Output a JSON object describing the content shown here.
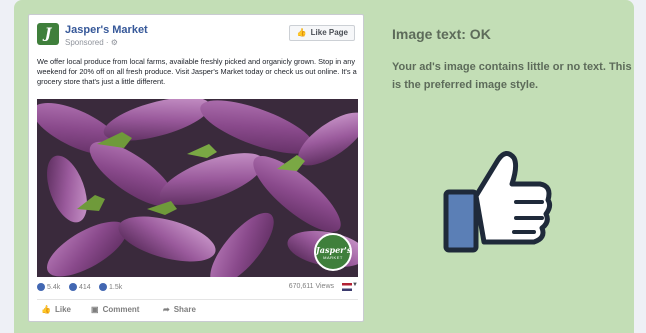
{
  "post": {
    "page_name": "Jasper's Market",
    "logo_letter": "J",
    "sponsored": "Sponsored · ⚙",
    "like_page_label": "Like Page",
    "body": "We offer local produce from local farms, available freshly picked and organicly grown. Stop in any weekend for 20% off on all fresh produce. Visit Jasper's Market today or check us out online. It's a grocery store that's just a little different.",
    "badge_name": "Jasper's",
    "badge_sub": "MARKET",
    "stats": {
      "likes": "5.4k",
      "comments": "414",
      "shares": "1.5k",
      "views": "670,611 Views"
    },
    "actions": {
      "like": "Like",
      "comment": "Comment",
      "share": "Share"
    }
  },
  "info": {
    "heading": "Image text: OK",
    "description": "Your ad's image contains little or no text. This is the preferred image style."
  },
  "colors": {
    "panel": "#c3deb6",
    "page_bg": "#eef0f6",
    "link": "#365899",
    "thumb_sleeve": "#5b7fb6",
    "eggplant": "#7a3f7c"
  },
  "icons": [
    "thumbs-up-icon",
    "like-icon",
    "comment-icon",
    "share-icon",
    "flag-icon",
    "chevron-down-icon"
  ]
}
